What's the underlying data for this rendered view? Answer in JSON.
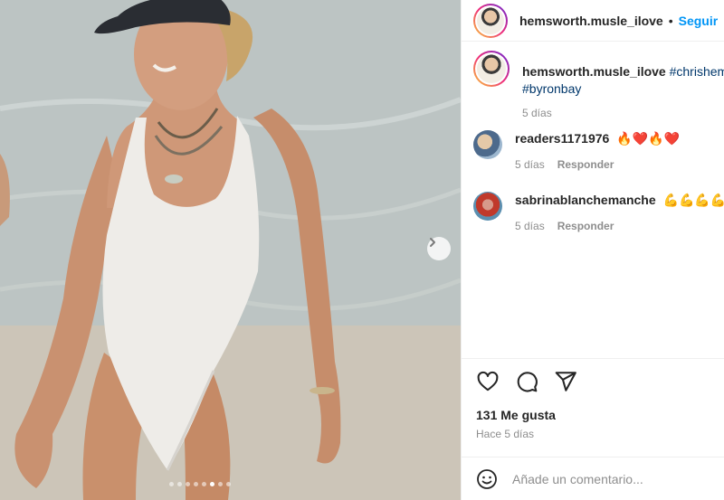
{
  "post": {
    "username": "hemsworth.musle_ilove",
    "separator": "•",
    "follow_label": "Seguir",
    "carousel": {
      "total_slides": 8,
      "active_slide": 6
    }
  },
  "caption": {
    "username": "hemsworth.musle_ilove",
    "text_line1": "#chrishem",
    "text_line2": "#byronbay",
    "time": "5 días"
  },
  "comments": [
    {
      "username": "readers1171976",
      "text": "🔥❤️🔥❤️",
      "time": "5 días",
      "reply_label": "Responder"
    },
    {
      "username": "sabrinablanchemanche",
      "text": "💪💪💪💪",
      "time": "5 días",
      "reply_label": "Responder"
    }
  ],
  "actions": {
    "like_icon": "heart-icon",
    "comment_icon": "comment-icon",
    "share_icon": "paper-plane-icon",
    "likes_text": "131 Me gusta",
    "posted_time": "Hace 5 días"
  },
  "add_comment": {
    "emoji_icon": "smiley-icon",
    "placeholder": "Añade un comentario..."
  },
  "colors": {
    "accent": "#0095f6",
    "text": "#262626",
    "muted": "#8e8e8e"
  }
}
